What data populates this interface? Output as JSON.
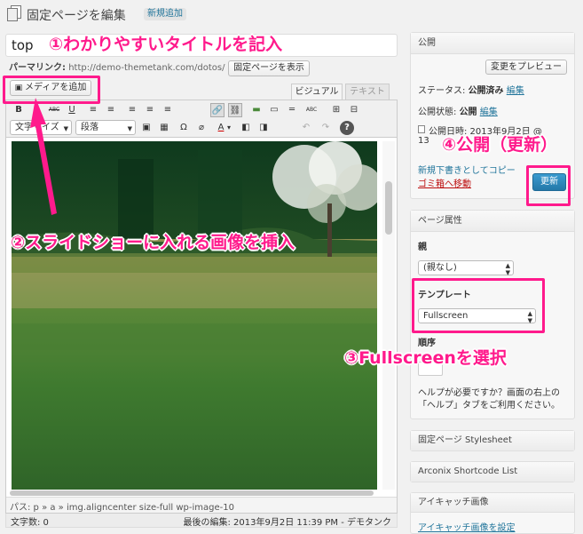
{
  "header": {
    "title": "固定ページを編集",
    "add_new": "新規追加"
  },
  "title_input": {
    "value": "top"
  },
  "permalink": {
    "label": "パーマリンク:",
    "url": "http://demo-themetank.com/dotos/",
    "view_button": "固定ページを表示"
  },
  "media": {
    "add_button": "メディアを追加"
  },
  "editor_tabs": {
    "visual": "ビジュアル",
    "text": "テキスト"
  },
  "toolbar": {
    "row1": [
      "B",
      "I",
      "ABC",
      "U",
      "≡",
      "≡",
      "≡",
      "≡",
      "≡",
      "🔗",
      "⛓",
      "▬",
      "▭",
      "═",
      "ABC",
      "⊞",
      "⊟"
    ],
    "font_size": "文字サイズ",
    "format": "段落",
    "row2": [
      "▣",
      "▦",
      "Ω",
      "⌀",
      "A",
      "▾",
      "◧",
      "◨",
      "↶",
      "↷",
      "?"
    ]
  },
  "status": {
    "path": "パス: p » a » img.aligncenter size-full wp-image-10",
    "word_count": "文字数: 0",
    "last_edit": "最後の編集: 2013年9月2日 11:39 PM - デモタンク"
  },
  "publish": {
    "heading": "公開",
    "preview_button": "変更をプレビュー",
    "status_label": "ステータス:",
    "status_value": "公開済み",
    "status_edit": "編集",
    "visibility_label": "公開状態:",
    "visibility_value": "公開",
    "visibility_edit": "編集",
    "date_line1": "公開日時: 2013年9月2日 @",
    "date_line2": "13",
    "copy_link": "新規下書きとしてコピー",
    "trash_link": "ゴミ箱へ移動",
    "update_button": "更新"
  },
  "page_attributes": {
    "heading": "ページ属性",
    "parent_label": "親",
    "parent_value": "(親なし)",
    "template_label": "テンプレート",
    "template_value": "Fullscreen",
    "order_label": "順序",
    "help_text_1": "ヘルプが必要ですか？画面の右上の",
    "help_text_2": "「ヘルプ」タブをご利用ください。"
  },
  "boxes": {
    "stylesheet": "固定ページ Stylesheet",
    "shortcode": "Arconix Shortcode List",
    "eyecatch_heading": "アイキャッチ画像",
    "eyecatch_link": "アイキャッチ画像を設定"
  },
  "annotations": {
    "a1": "①わかりやすいタイトルを記入",
    "a2": "②スライドショーに入れる画像を挿入",
    "a3": "③Fullscreenを選択",
    "a4": "④公開（更新）"
  },
  "colors": {
    "accent": "#ff1a8c",
    "link": "#21759b",
    "primary_button": "#2e8fc2"
  }
}
